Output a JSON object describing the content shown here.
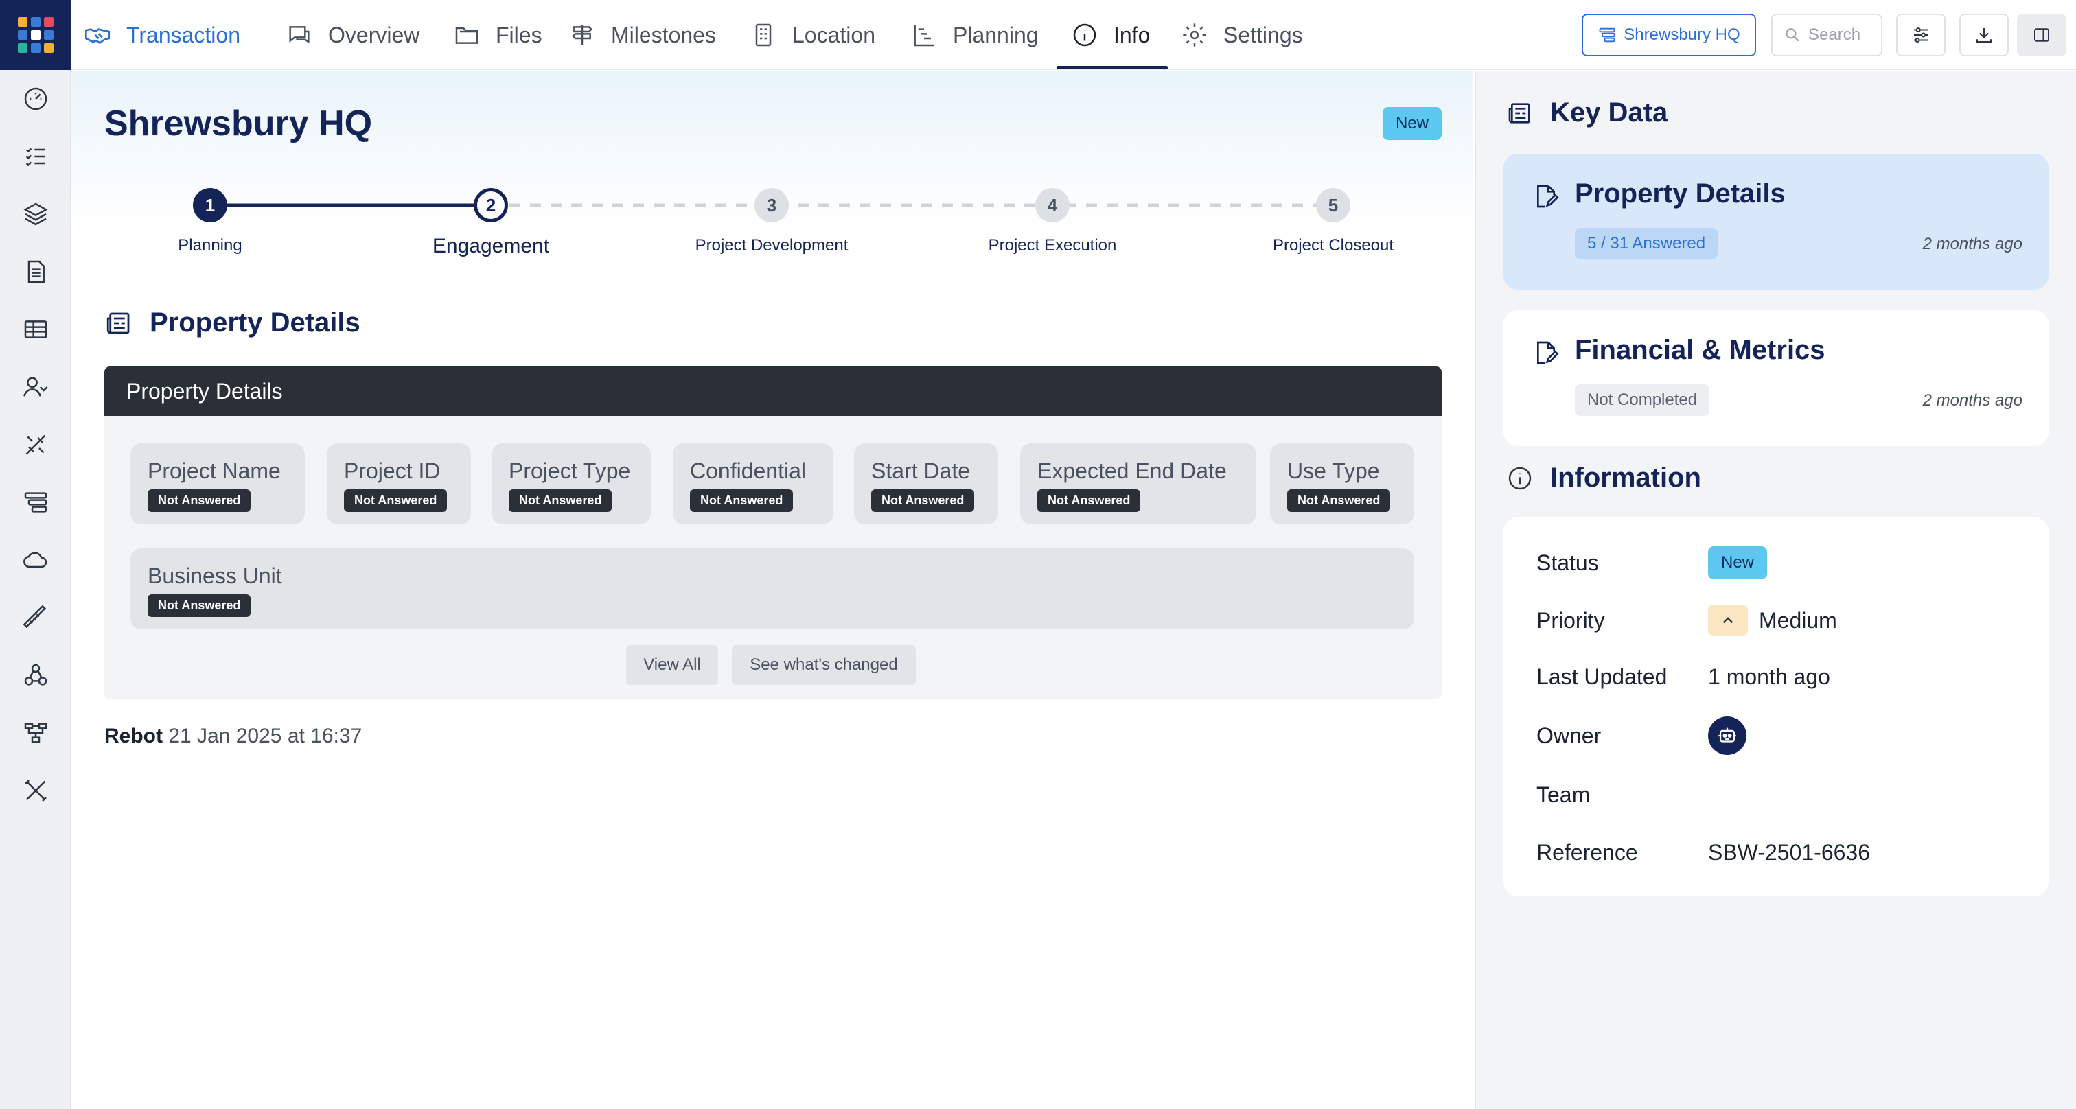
{
  "topbar": {
    "brand_label": "Transaction",
    "tabs": [
      {
        "label": "Overview"
      },
      {
        "label": "Files"
      },
      {
        "label": "Milestones"
      },
      {
        "label": "Location"
      },
      {
        "label": "Planning"
      },
      {
        "label": "Info"
      },
      {
        "label": "Settings"
      }
    ],
    "active_tab": "Info",
    "hq_button": "Shrewsbury HQ",
    "search_placeholder": "Search"
  },
  "sidebar": {
    "items": [
      "dashboard-icon",
      "checklist-icon",
      "layers-icon",
      "document-icon",
      "table-icon",
      "contacts-icon",
      "tools-icon",
      "pipeline-icon",
      "cloud-icon",
      "ruler-icon",
      "webhook-icon",
      "hierarchy-icon",
      "settings-tools-icon"
    ]
  },
  "main": {
    "title": "Shrewsbury HQ",
    "status_badge": "New",
    "steps": [
      {
        "num": "1",
        "label": "Planning",
        "state": "done"
      },
      {
        "num": "2",
        "label": "Engagement",
        "state": "current"
      },
      {
        "num": "3",
        "label": "Project Development",
        "state": "todo"
      },
      {
        "num": "4",
        "label": "Project Execution",
        "state": "todo"
      },
      {
        "num": "5",
        "label": "Project Closeout",
        "state": "todo"
      }
    ],
    "section_title": "Property Details",
    "panel": {
      "header": "Property Details",
      "fields": [
        {
          "label": "Project Name",
          "status": "Not Answered"
        },
        {
          "label": "Project ID",
          "status": "Not Answered"
        },
        {
          "label": "Project Type",
          "status": "Not Answered"
        },
        {
          "label": "Confidential",
          "status": "Not Answered"
        },
        {
          "label": "Start Date",
          "status": "Not Answered"
        },
        {
          "label": "Expected End Date",
          "status": "Not Answered"
        },
        {
          "label": "Use Type",
          "status": "Not Answered"
        },
        {
          "label": "Business Unit",
          "status": "Not Answered"
        }
      ],
      "view_all": "View All",
      "see_changed": "See what's changed"
    },
    "activity": {
      "author": "Rebot",
      "time": "21 Jan 2025 at 16:37"
    }
  },
  "right": {
    "key_data_title": "Key Data",
    "cards": [
      {
        "title": "Property Details",
        "tag": "5 / 31 Answered",
        "time": "2 months ago"
      },
      {
        "title": "Financial & Metrics",
        "tag": "Not Completed",
        "time": "2 months ago"
      }
    ],
    "information_title": "Information",
    "info": {
      "status_label": "Status",
      "status_value": "New",
      "priority_label": "Priority",
      "priority_value": "Medium",
      "updated_label": "Last Updated",
      "updated_value": "1 month ago",
      "owner_label": "Owner",
      "team_label": "Team",
      "reference_label": "Reference",
      "reference_value": "SBW-2501-6636"
    }
  },
  "colors": {
    "navy": "#142459",
    "brand_blue": "#2a6fd6",
    "badge_cyan": "#5cc8ef",
    "dark_panel": "#2a2f38"
  }
}
